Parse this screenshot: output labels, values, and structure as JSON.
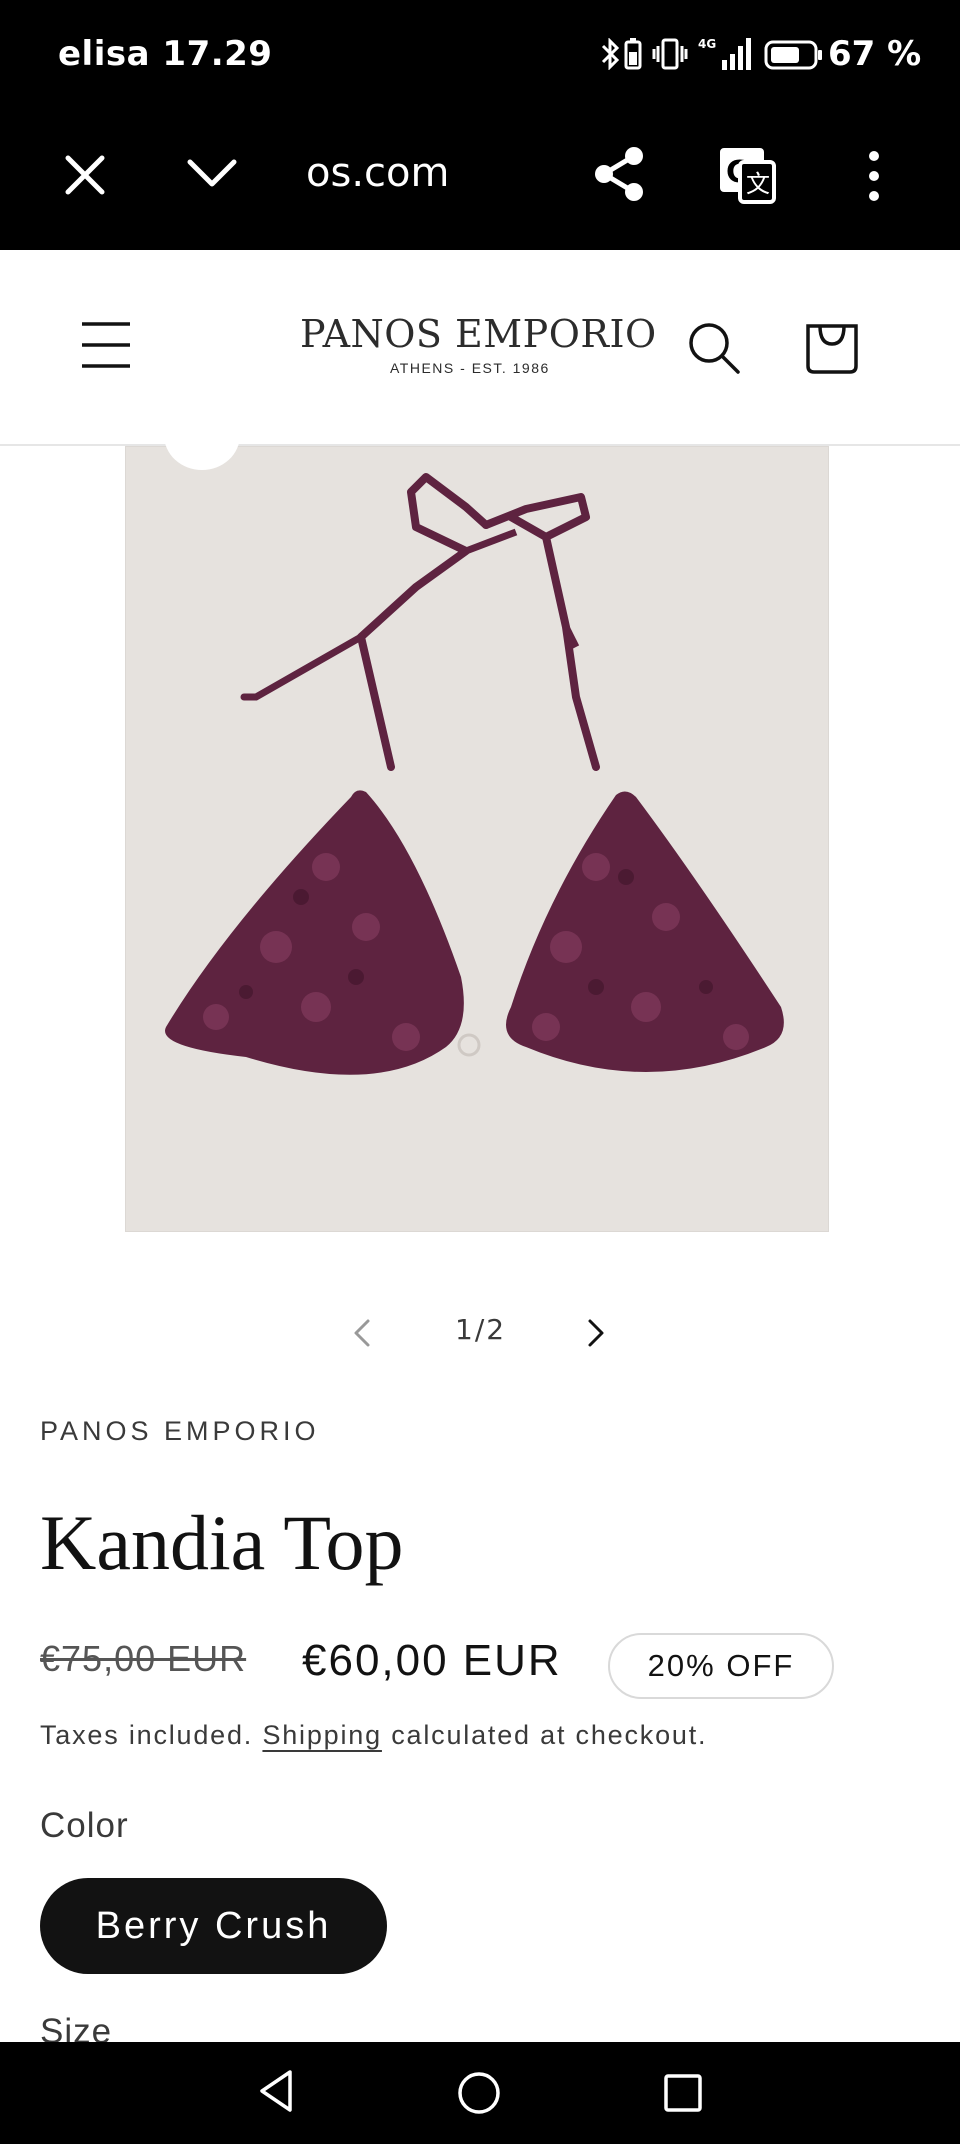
{
  "status_bar": {
    "carrier": "elisa",
    "time": "17.29",
    "battery": "67 %"
  },
  "browser": {
    "url": "os.com"
  },
  "header": {
    "brand": "PANOS EMPORIO",
    "tagline": "ATHENS - EST. 1986"
  },
  "gallery": {
    "pager": "1/2"
  },
  "product": {
    "vendor": "PANOS EMPORIO",
    "title": "Kandia Top",
    "old_price": "€75,00 EUR",
    "price": "€60,00 EUR",
    "badge": "20% OFF",
    "tax_prefix": "Taxes included.",
    "shipping_link": "Shipping",
    "tax_suffix": "calculated at checkout.",
    "color_label": "Color",
    "color_selected": "Berry Crush",
    "size_label": "Size"
  },
  "colors": {
    "product": "#5e2340",
    "image_bg": "#e6e2de"
  }
}
